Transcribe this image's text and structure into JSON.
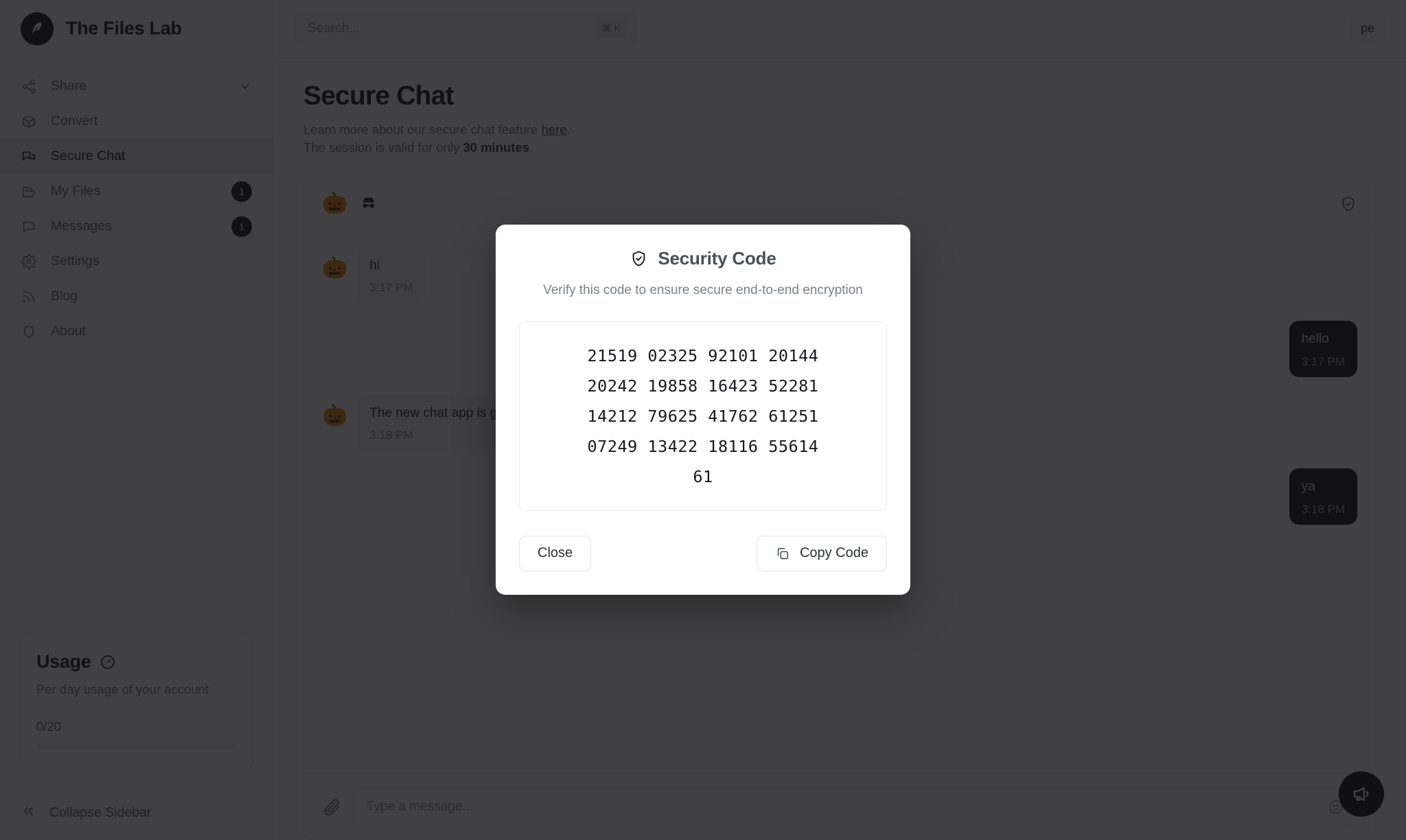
{
  "brand": {
    "name": "The Files Lab",
    "logo_icon": "feather-logo-icon"
  },
  "search": {
    "placeholder": "Search...",
    "value": "",
    "shortcut": "⌘ K",
    "icon": "search-icon"
  },
  "topbar": {
    "profile_label": "pe"
  },
  "sidebar": {
    "items": [
      {
        "label": "Share",
        "icon": "share-icon",
        "badge": null,
        "chevron": true,
        "active": false
      },
      {
        "label": "Convert",
        "icon": "box-icon",
        "badge": null,
        "chevron": false,
        "active": false
      },
      {
        "label": "Secure Chat",
        "icon": "chat-bubbles-icon",
        "badge": null,
        "chevron": false,
        "active": true
      },
      {
        "label": "My Files",
        "icon": "folder-icon",
        "badge": "1",
        "chevron": false,
        "active": false
      },
      {
        "label": "Messages",
        "icon": "message-icon",
        "badge": "1",
        "chevron": false,
        "active": false
      },
      {
        "label": "Settings",
        "icon": "gear-icon",
        "badge": null,
        "chevron": false,
        "active": false
      },
      {
        "label": "Blog",
        "icon": "rss-icon",
        "badge": null,
        "chevron": false,
        "active": false
      },
      {
        "label": "About",
        "icon": "shield-icon",
        "badge": null,
        "chevron": false,
        "active": false
      }
    ],
    "usage": {
      "title": "Usage",
      "title_icon": "gauge-icon",
      "subtitle": "Per day usage of your account",
      "count": "0/20",
      "progress_percent": 0
    },
    "collapse": {
      "label": "Collapse Sidebar",
      "icon": "chevrons-left-icon"
    }
  },
  "main": {
    "page_title": "Secure Chat",
    "sub_line1_pre": "Learn more about our secure chat feature ",
    "sub_line1_link": "here",
    "sub_line1_post": ".",
    "sub_line2_pre": "The session is valid for only ",
    "sub_line2_strong": "30 minutes",
    "sub_line2_post": ".",
    "chat_header": {
      "avatar": "🎃",
      "incognito_icon": "incognito-icon",
      "status_icon": "shield-check-icon"
    },
    "messages": [
      {
        "side": "them",
        "avatar": "🎃",
        "text": "hi",
        "time": "3:17 PM"
      },
      {
        "side": "me",
        "avatar": "",
        "text": "hello",
        "time": "3:17 PM"
      },
      {
        "side": "them",
        "avatar": "🎃",
        "text": "The new chat app is great!",
        "time": "3:18 PM"
      },
      {
        "side": "me",
        "avatar": "",
        "text": "ya",
        "time": "3:18 PM"
      }
    ],
    "composer": {
      "attach_icon": "paperclip-icon",
      "placeholder": "Type a message...",
      "value": "",
      "emoji_icon": "smiley-icon"
    },
    "fab": {
      "icon": "megaphone-icon"
    }
  },
  "modal": {
    "title": "Security Code",
    "title_icon": "shield-check-icon",
    "subtitle": "Verify this code to ensure secure end-to-end encryption",
    "code_lines": [
      "21519 02325 92101 20144",
      "20242 19858 16423 52281",
      "14212 79625 41762 61251",
      "07249 13422 18116 55614",
      "61"
    ],
    "close_label": "Close",
    "copy_label": "Copy Code",
    "copy_icon": "copy-icon"
  },
  "colors": {
    "accent": "#101114",
    "surface": "#ffffff",
    "muted": "#7c8089",
    "overlay": "rgba(18,18,20,0.80)"
  }
}
